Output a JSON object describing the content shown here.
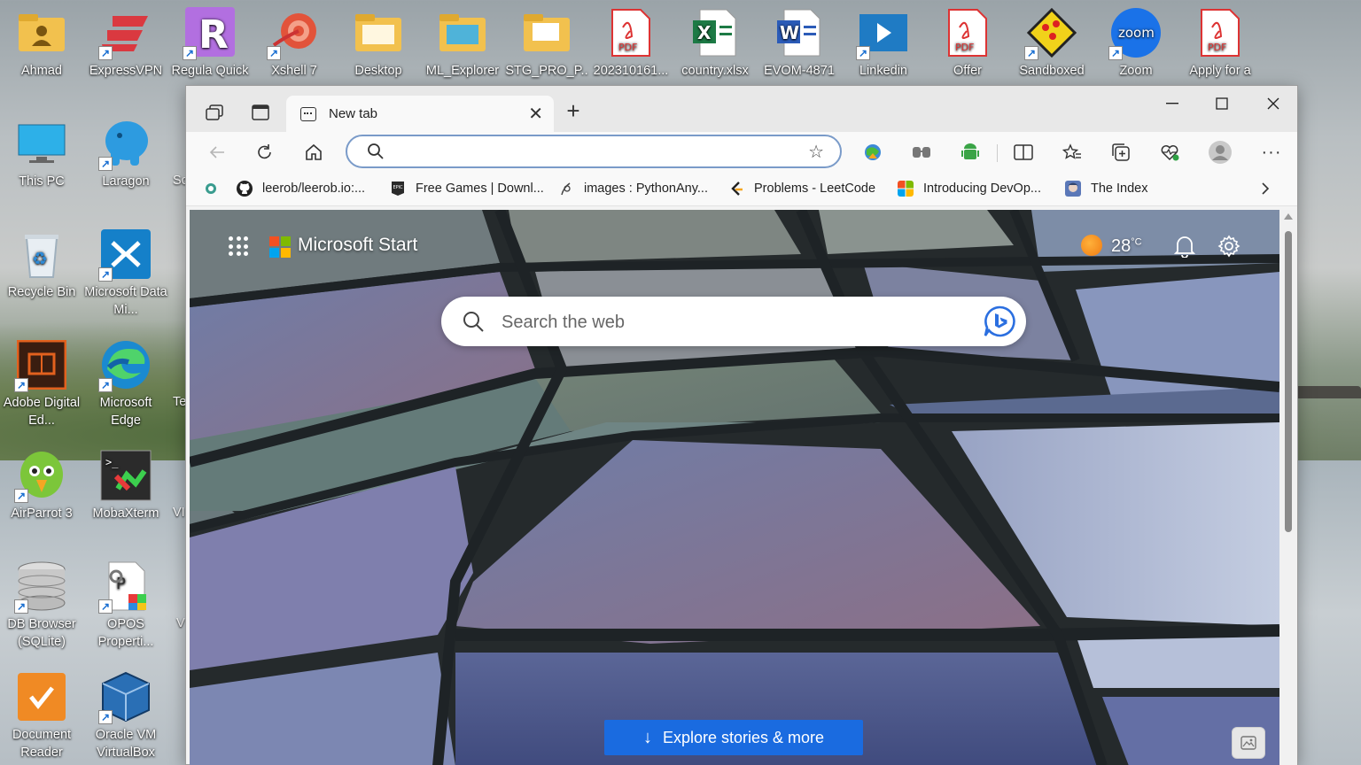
{
  "desktop": {
    "icons_top_row": [
      {
        "label": "Ahmad"
      },
      {
        "label": "ExpressVPN"
      },
      {
        "label": "Regula Quick"
      },
      {
        "label": "Xshell 7"
      },
      {
        "label": "Desktop"
      },
      {
        "label": "ML_Explorer"
      },
      {
        "label": "STG_PRO_P..."
      },
      {
        "label": "202310161..."
      },
      {
        "label": "country.xlsx"
      },
      {
        "label": "EVOM-4871"
      },
      {
        "label": "Linkedin"
      },
      {
        "label": "Offer"
      },
      {
        "label": "Sandboxed"
      },
      {
        "label": "Zoom"
      },
      {
        "label": "Apply for a"
      }
    ],
    "icons_col1": [
      {
        "label": "This PC"
      },
      {
        "label": "Recycle Bin"
      },
      {
        "label": "Adobe Digital Ed..."
      },
      {
        "label": "AirParrot 3"
      },
      {
        "label": "DB Browser (SQLite)"
      },
      {
        "label": "Document Reader"
      }
    ],
    "icons_col2": [
      {
        "label": "Laragon"
      },
      {
        "label": "Microsoft Data Mi..."
      },
      {
        "label": "Microsoft Edge"
      },
      {
        "label": "MobaXterm"
      },
      {
        "label": "OPOS Properti..."
      },
      {
        "label": "Oracle VM VirtualBox"
      }
    ],
    "partial_col3": [
      "Sc",
      "Te",
      "VI",
      "V"
    ]
  },
  "browser": {
    "tab_title": "New tab",
    "address_value": "",
    "bookmarks": [
      {
        "label": "leerob/leerob.io:..."
      },
      {
        "label": "Free Games | Downl..."
      },
      {
        "label": "images : PythonAny..."
      },
      {
        "label": "Problems - LeetCode"
      },
      {
        "label": "Introducing DevOp..."
      },
      {
        "label": "The Index"
      }
    ],
    "colors": {
      "accent": "#1a6be0",
      "address_border": "#7a9bc9"
    }
  },
  "page": {
    "brand": "Microsoft Start",
    "temperature": "28",
    "temperature_unit": "°C",
    "search_placeholder": "Search the web",
    "explore_label": "Explore stories & more"
  }
}
